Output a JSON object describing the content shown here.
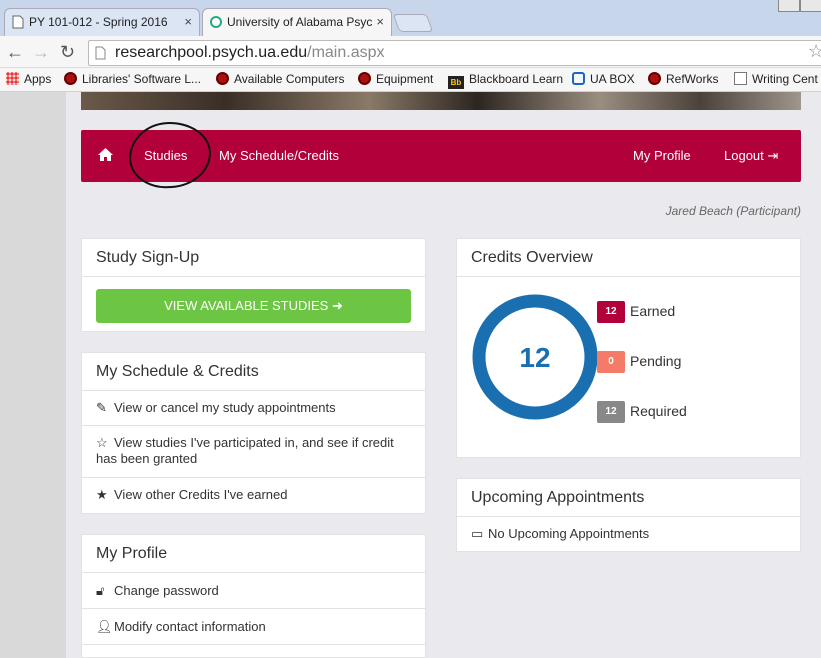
{
  "browser": {
    "tabs": [
      {
        "title": "PY 101-012 - Spring 2016",
        "close": "×"
      },
      {
        "title": "University of Alabama Psyc",
        "close": "×"
      }
    ],
    "url_host": "researchpool.psych.ua.edu",
    "url_path": "/main.aspx",
    "bookmarks": [
      {
        "label": "Apps",
        "icon": "apps-icon"
      },
      {
        "label": "Libraries' Software L...",
        "icon": "ua-seal-icon"
      },
      {
        "label": "Available Computers",
        "icon": "ua-seal-icon"
      },
      {
        "label": "Equipment",
        "icon": "ua-seal-icon"
      },
      {
        "label": "Blackboard Learn",
        "icon": "blackboard-icon"
      },
      {
        "label": "UA BOX",
        "icon": "box-icon"
      },
      {
        "label": "RefWorks",
        "icon": "ua-seal-icon"
      },
      {
        "label": "Writing Cent",
        "icon": "page-icon"
      }
    ]
  },
  "nav": {
    "studies": "Studies",
    "schedule": "My Schedule/Credits",
    "profile": "My Profile",
    "logout": "Logout"
  },
  "user": "Jared Beach (Participant)",
  "signup": {
    "title": "Study Sign-Up",
    "button": "VIEW AVAILABLE STUDIES"
  },
  "schedule": {
    "title": "My Schedule & Credits",
    "links": [
      "View or cancel my study appointments",
      "View studies I've participated in, and see if credit has been granted",
      "View other Credits I've earned"
    ]
  },
  "profile": {
    "title": "My Profile",
    "links": [
      "Change password",
      "Modify contact information"
    ]
  },
  "credits": {
    "title": "Credits Overview",
    "total": "12",
    "earned": {
      "value": "12",
      "label": "Earned",
      "color": "#b2003a"
    },
    "pending": {
      "value": "0",
      "label": "Pending",
      "color": "#f47b67"
    },
    "required": {
      "value": "12",
      "label": "Required",
      "color": "#888888"
    }
  },
  "appointments": {
    "title": "Upcoming Appointments",
    "empty": "No Upcoming Appointments"
  },
  "colors": {
    "brand": "#b2003a",
    "accent_blue": "#1a6fb0",
    "green": "#6cc644"
  }
}
